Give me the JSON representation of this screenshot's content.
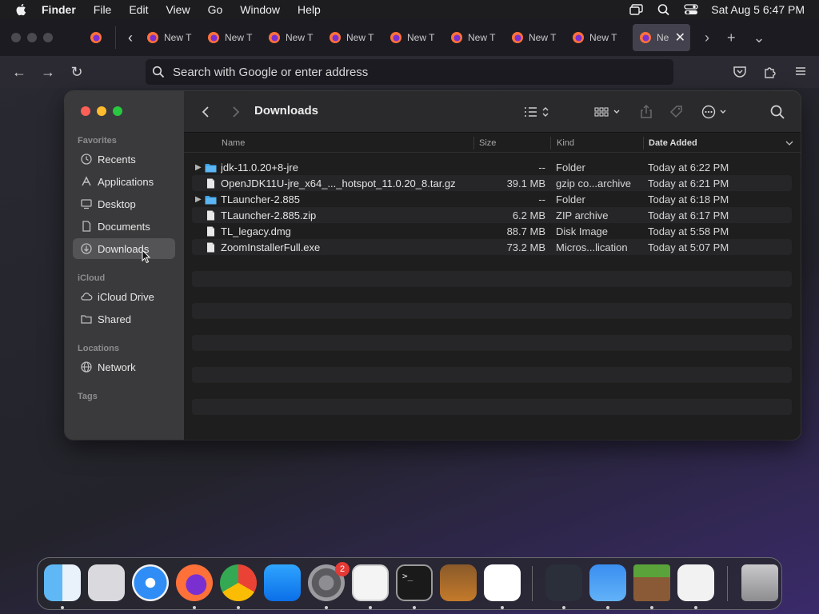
{
  "menubar": {
    "app_name": "Finder",
    "menus": [
      "File",
      "Edit",
      "View",
      "Go",
      "Window",
      "Help"
    ],
    "clock": "Sat Aug 5  6:47 PM"
  },
  "browser": {
    "tab_label": "New T",
    "active_tab_label": "Ne",
    "url_placeholder": "Search with Google or enter address"
  },
  "finder": {
    "title": "Downloads",
    "sidebar": {
      "favorites_heading": "Favorites",
      "favorites": [
        {
          "label": "Recents",
          "icon": "clock-icon"
        },
        {
          "label": "Applications",
          "icon": "applications-icon"
        },
        {
          "label": "Desktop",
          "icon": "desktop-icon"
        },
        {
          "label": "Documents",
          "icon": "document-icon"
        },
        {
          "label": "Downloads",
          "icon": "download-icon"
        }
      ],
      "icloud_heading": "iCloud",
      "icloud": [
        {
          "label": "iCloud Drive",
          "icon": "cloud-icon"
        },
        {
          "label": "Shared",
          "icon": "shared-folder-icon"
        }
      ],
      "locations_heading": "Locations",
      "locations": [
        {
          "label": "Network",
          "icon": "network-icon"
        }
      ],
      "tags_heading": "Tags"
    },
    "columns": {
      "name": "Name",
      "size": "Size",
      "kind": "Kind",
      "date": "Date Added"
    },
    "files": [
      {
        "name": "jdk-11.0.20+8-jre",
        "size": "--",
        "kind": "Folder",
        "date": "Today at 6:22 PM",
        "type": "folder"
      },
      {
        "name": "OpenJDK11U-jre_x64_..._hotspot_11.0.20_8.tar.gz",
        "size": "39.1 MB",
        "kind": "gzip co...archive",
        "date": "Today at 6:21 PM",
        "type": "file"
      },
      {
        "name": "TLauncher-2.885",
        "size": "--",
        "kind": "Folder",
        "date": "Today at 6:18 PM",
        "type": "folder"
      },
      {
        "name": "TLauncher-2.885.zip",
        "size": "6.2 MB",
        "kind": "ZIP archive",
        "date": "Today at 6:17 PM",
        "type": "file"
      },
      {
        "name": "TL_legacy.dmg",
        "size": "88.7 MB",
        "kind": "Disk Image",
        "date": "Today at 5:58 PM",
        "type": "file"
      },
      {
        "name": "ZoomInstallerFull.exe",
        "size": "73.2 MB",
        "kind": "Micros...lication",
        "date": "Today at 5:07 PM",
        "type": "file"
      }
    ]
  },
  "dock": {
    "apps": [
      "finder-icon",
      "launchpad-icon",
      "safari-icon",
      "firefox-icon",
      "chrome-icon",
      "app-store-icon",
      "system-settings-icon",
      "textedit-icon",
      "terminal-icon",
      "garageband-icon",
      "vscode-icon",
      "davinci-resolve-icon",
      "weather-icon",
      "minecraft-icon",
      "java-icon",
      "trash-icon"
    ],
    "settings_badge": "2"
  }
}
